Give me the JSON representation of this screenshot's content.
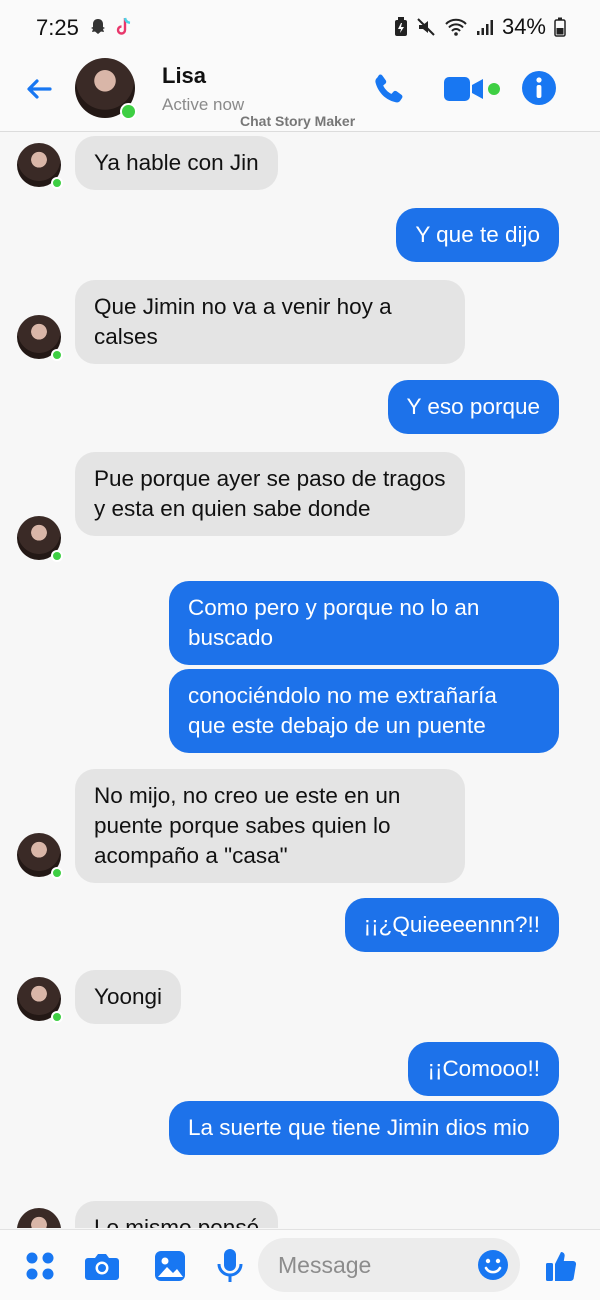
{
  "status_bar": {
    "time": "7:25",
    "battery": "34%",
    "icons": [
      "snapchat-icon",
      "tiktok-icon",
      "battery-saver-icon",
      "mute-icon",
      "wifi-icon",
      "signal-icon",
      "battery-icon"
    ]
  },
  "header": {
    "contact_name": "Lisa",
    "status": "Active now",
    "watermark": "Chat Story Maker",
    "accent_color": "#1877f2"
  },
  "messages": [
    {
      "from": "in",
      "text": "Ya hable con Jin"
    },
    {
      "from": "out",
      "text": "Y que te dijo"
    },
    {
      "from": "in",
      "text": "Que Jimin no va a venir hoy a calses"
    },
    {
      "from": "out",
      "text": "Y eso porque"
    },
    {
      "from": "in",
      "text": "Pue porque ayer se paso de tragos y esta en quien sabe donde"
    },
    {
      "from": "out",
      "text": "Como pero y porque no lo an buscado"
    },
    {
      "from": "out",
      "text": "conociéndolo no me extrañaría que este debajo de un puente"
    },
    {
      "from": "in",
      "text": "No mijo, no creo ue este en un puente porque sabes quien lo acompaño a \"casa\""
    },
    {
      "from": "out",
      "text": "¡¡¿Quieeeennn?!!"
    },
    {
      "from": "in",
      "text": "Yoongi"
    },
    {
      "from": "out",
      "text": "¡¡Comooo!!"
    },
    {
      "from": "out",
      "text": "La suerte que tiene Jimin dios mio"
    },
    {
      "from": "in",
      "text": "Lo mismo pensé"
    }
  ],
  "composer": {
    "placeholder": "Message",
    "buttons": [
      "apps-icon",
      "camera-icon",
      "gallery-icon",
      "microphone-icon",
      "emoji-icon",
      "like-icon"
    ]
  }
}
